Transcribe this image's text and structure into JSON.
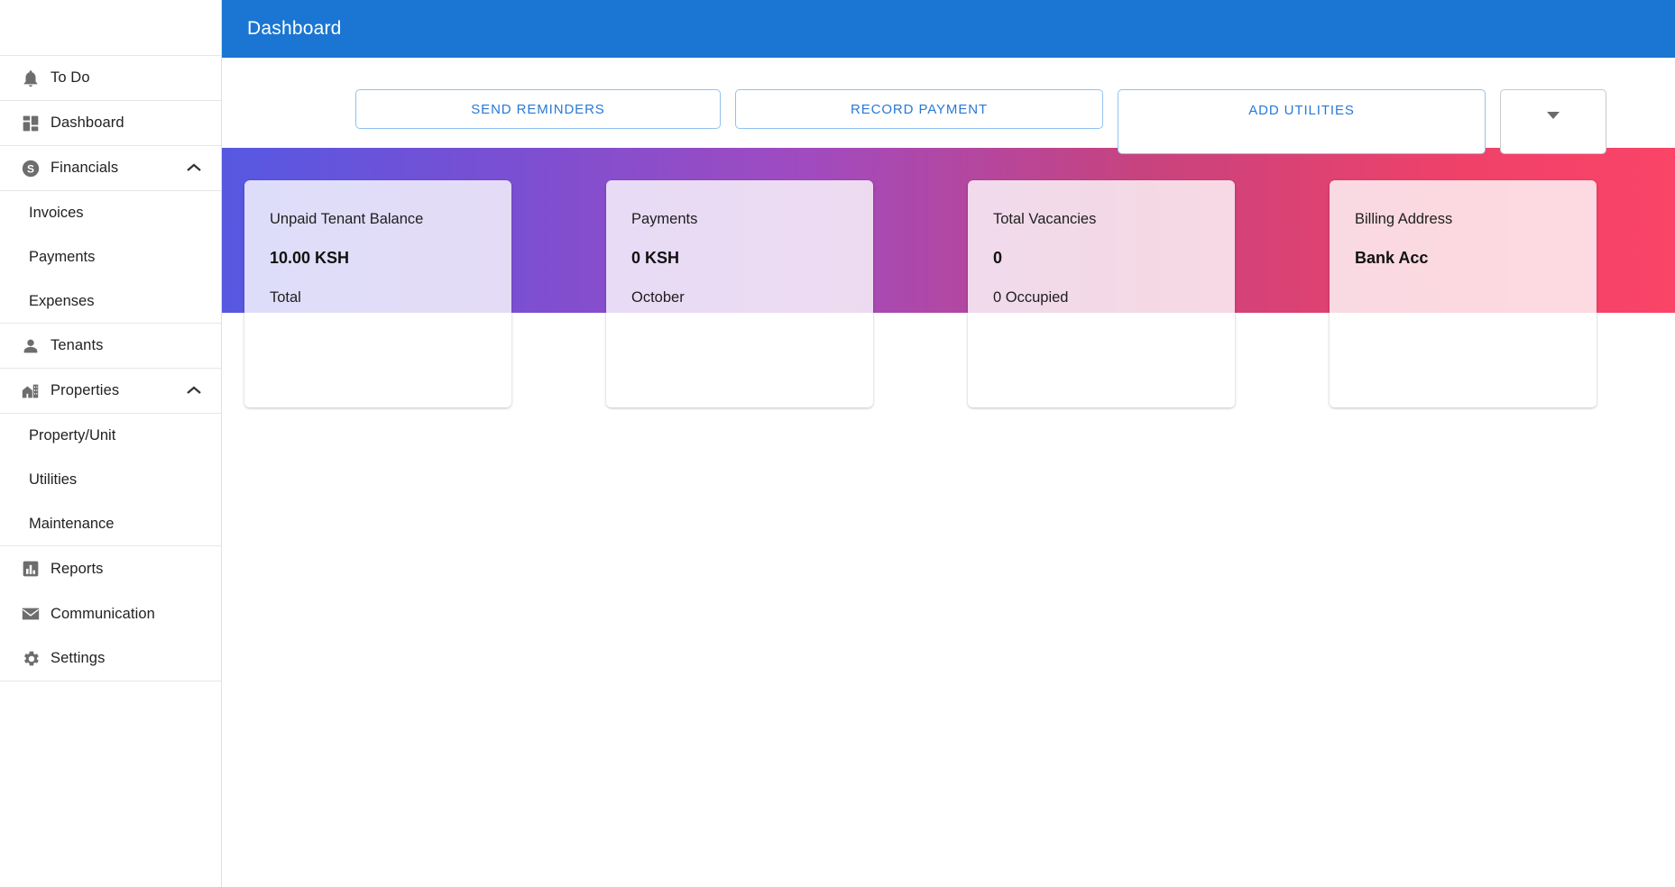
{
  "theme": {
    "header_blue": "#1a76d2",
    "button_blue": "#2979d6",
    "gradient_from": "#5658e2",
    "gradient_to": "#fa4468"
  },
  "header": {
    "title": "Dashboard"
  },
  "sidebar": {
    "items": [
      {
        "label": "To Do",
        "icon": "bell-icon",
        "type": "item"
      },
      {
        "label": "Dashboard",
        "icon": "dashboard-grid-icon",
        "type": "item"
      },
      {
        "label": "Financials",
        "icon": "dollar-circle-icon",
        "type": "group",
        "expanded": true,
        "chevron": "chevron-up-icon"
      },
      {
        "label": "Invoices",
        "type": "sub"
      },
      {
        "label": "Payments",
        "type": "sub"
      },
      {
        "label": "Expenses",
        "type": "sub"
      },
      {
        "label": "Tenants",
        "icon": "person-icon",
        "type": "item"
      },
      {
        "label": "Properties",
        "icon": "building-icon",
        "type": "group",
        "expanded": true,
        "chevron": "chevron-up-icon"
      },
      {
        "label": "Property/Unit",
        "type": "sub"
      },
      {
        "label": "Utilities",
        "type": "sub"
      },
      {
        "label": "Maintenance",
        "type": "sub"
      },
      {
        "label": "Reports",
        "icon": "bar-chart-icon",
        "type": "item"
      },
      {
        "label": "Communication",
        "icon": "envelope-icon",
        "type": "item"
      },
      {
        "label": "Settings",
        "icon": "gear-icon",
        "type": "item"
      }
    ]
  },
  "toolbar": {
    "send_reminders": "SEND REMINDERS",
    "record_payment": "RECORD PAYMENT",
    "add_utilities": "ADD UTILITIES",
    "dropdown_icon": "chevron-down-icon",
    "dropdown_value": ""
  },
  "cards": [
    {
      "title": "Unpaid Tenant Balance",
      "value": "10.00 KSH",
      "sub": "Total"
    },
    {
      "title": "Payments",
      "value": "0 KSH",
      "sub": "October"
    },
    {
      "title": "Total Vacancies",
      "value": "0",
      "sub": "0 Occupied"
    },
    {
      "title": "Billing Address",
      "value": "Bank Acc",
      "sub": ""
    }
  ]
}
